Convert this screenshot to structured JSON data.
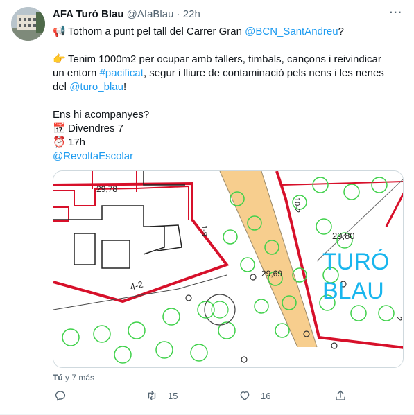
{
  "tweet": {
    "display_name": "AFA Turó Blau",
    "handle": "@AfaBlau",
    "separator": "·",
    "time": "22h",
    "lines": [
      {
        "emoji": "📢",
        "pre": "Tothom a punt pel tall del Carrer Gran ",
        "link": "@BCN_SantAndreu",
        "post": "?"
      },
      {
        "emoji": "",
        "pre": "",
        "link": "",
        "post": ""
      },
      {
        "emoji": "👉",
        "pre": "Tenim 1000m2 per ocupar amb tallers, timbals, cançons i reivindicar",
        "link": "",
        "post": ""
      },
      {
        "emoji": "",
        "pre": "un entorn ",
        "link": "#pacificat",
        "post": ", segur i lliure de contaminació pels nens i les nenes"
      },
      {
        "emoji": "",
        "pre": "del ",
        "link": "@turo_blau",
        "post": "!"
      },
      {
        "emoji": "",
        "pre": "",
        "link": "",
        "post": ""
      },
      {
        "emoji": "",
        "pre": "Ens hi acompanyes?",
        "link": "",
        "post": ""
      },
      {
        "emoji": "📅",
        "pre": "Divendres 7",
        "link": "",
        "post": ""
      },
      {
        "emoji": "⏰",
        "pre": "17h",
        "link": "",
        "post": ""
      },
      {
        "emoji": "",
        "pre": "",
        "link": "@RevoltaEscolar",
        "post": ""
      }
    ],
    "map": {
      "labels": [
        "29,78",
        "1-9",
        "4-2",
        "29,69",
        "10-2",
        "29,80",
        "TURÓ",
        "BLAU",
        "2"
      ],
      "colors": {
        "building": "#d7102a",
        "tree": "#3fd14a",
        "road": "#f6c67a",
        "blue_text": "#19b6ee"
      }
    },
    "timestamp": {
      "device": "Tú",
      "rest": " y 7 más"
    },
    "actions": {
      "reply_count": "",
      "retweet_count": "15",
      "like_count": "16"
    },
    "colors": {
      "link": "#1d9bf0",
      "secondary": "#536471"
    }
  }
}
